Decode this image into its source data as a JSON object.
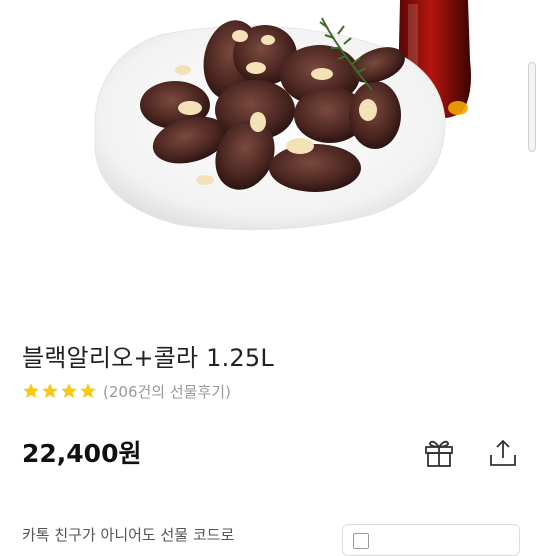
{
  "product": {
    "title": "블랙알리오+콜라 1.25L",
    "rating_stars": 4,
    "review_text": "(206건의 선물후기)",
    "price": "22,400원"
  },
  "actions": {
    "gift_icon": "gift-icon",
    "share_icon": "share-icon"
  },
  "bottom": {
    "notice_text": "카톡 친구가 아니어도 선물 코드로"
  },
  "colors": {
    "star": "#F6C915",
    "cola": "#B4150E"
  }
}
